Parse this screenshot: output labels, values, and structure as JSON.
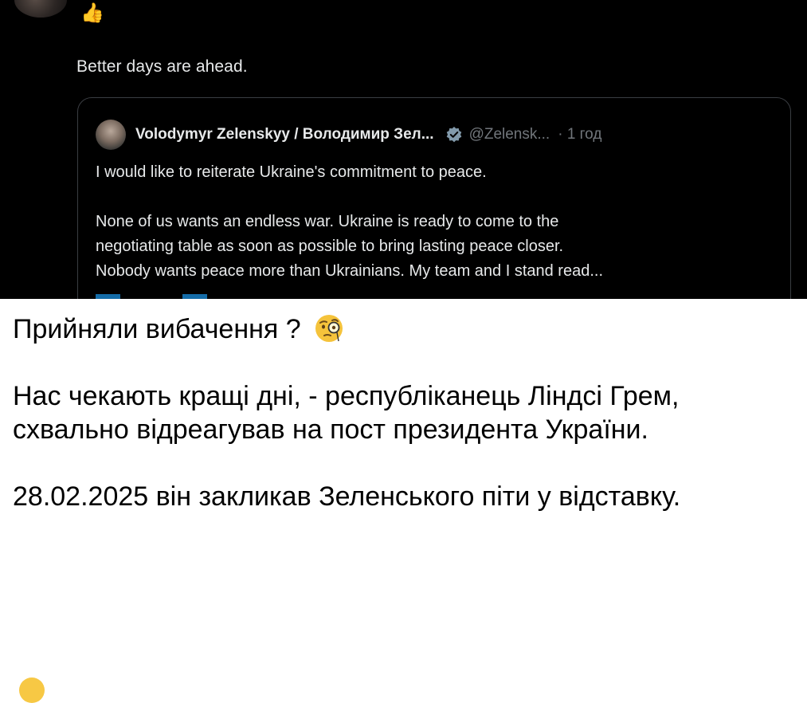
{
  "tweet": {
    "text": "Better days are ahead.",
    "thumbs_icon": "thumbs-up-icon",
    "quote": {
      "author_name": "Volodymyr Zelenskyy / Володимир Зел...",
      "handle": "@Zelensk...",
      "time": "· 1 год",
      "verified_color": "#829aab",
      "line1": "I would like to reiterate Ukraine's commitment to peace.",
      "line2": "None of us wants an endless war. Ukraine is ready to come to the",
      "line3": "negotiating table as soon as possible to bring lasting peace closer.",
      "line4": "Nobody wants peace more than Ukrainians. My team and I stand read..."
    }
  },
  "caption": {
    "line1": "Прийняли вибачення ?",
    "line1_icon": "face-with-monocle-icon",
    "paragraph2": "Нас чекають кращі дні, - республіканець Ліндсі Грем, схвально відреагував на пост президента України.",
    "paragraph3": "28.02.2025 він закликав Зеленського піти у відставку."
  },
  "colors": {
    "tweet_background": "#000000",
    "tweet_text": "#e7e9ea",
    "muted": "#71767b",
    "caption_text": "#000000"
  }
}
